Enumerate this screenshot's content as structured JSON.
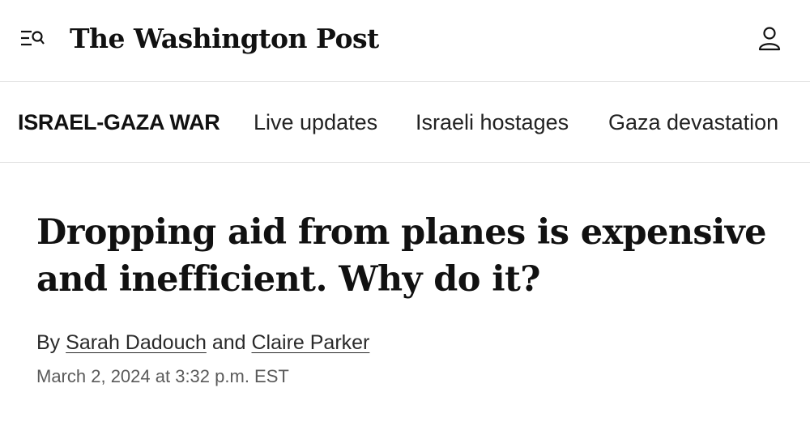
{
  "header": {
    "menu_icon": "menu-search-icon",
    "brand": "The Washington Post",
    "account_icon": "user-icon"
  },
  "section_nav": {
    "title": "ISRAEL-GAZA WAR",
    "items": [
      {
        "label": "Live updates"
      },
      {
        "label": "Israeli hostages"
      },
      {
        "label": "Gaza devastation"
      }
    ]
  },
  "article": {
    "headline": "Dropping aid from planes is expensive and inefficient. Why do it?",
    "byline": {
      "prefix": "By",
      "authors": [
        "Sarah Dadouch",
        "Claire Parker"
      ],
      "conjunction": "and"
    },
    "timestamp": "March 2, 2024 at 3:32 p.m. EST"
  },
  "colors": {
    "text": "#111111",
    "muted": "#5a5a5a",
    "divider": "#e3e3e3",
    "background": "#ffffff"
  }
}
